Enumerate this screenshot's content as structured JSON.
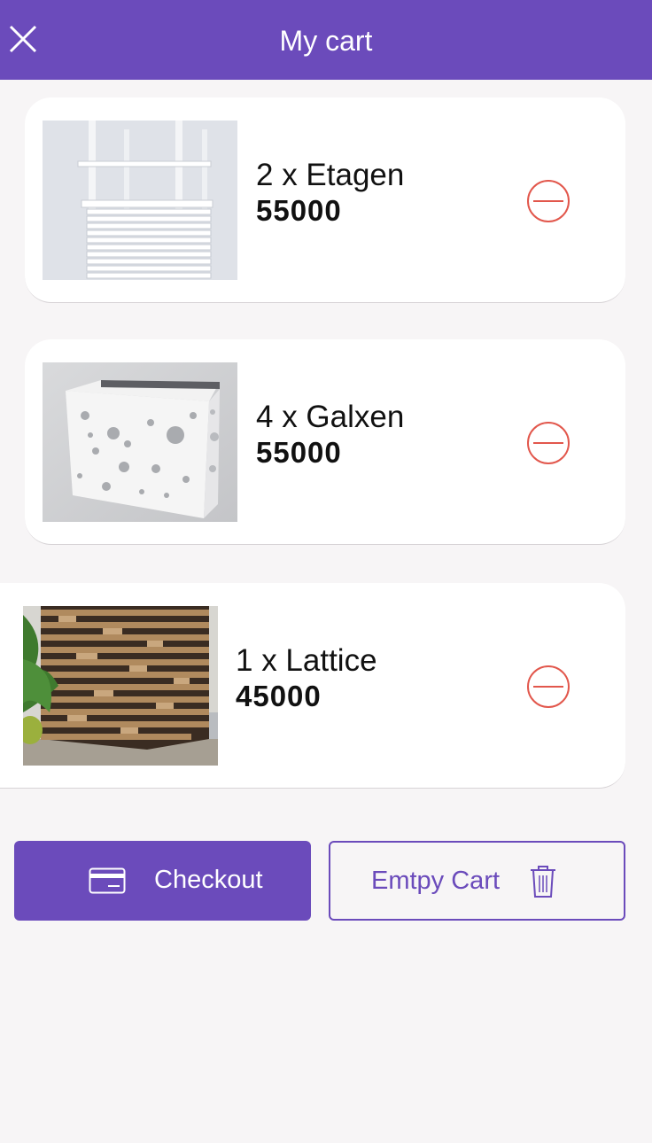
{
  "header": {
    "title": "My cart",
    "close_icon": "close-icon",
    "background": "#6b4bbb"
  },
  "cart": {
    "items": [
      {
        "name": "2 x Etagen",
        "price": "55000",
        "image": "white shelving unit product photo",
        "remove_icon": "remove-circle-icon"
      },
      {
        "name": "4 x Galxen",
        "price": "55000",
        "image": "white perforated cabinet product photo",
        "remove_icon": "remove-circle-icon"
      },
      {
        "name": "1 x Lattice",
        "price": "45000",
        "image": "wooden lattice planter product photo",
        "remove_icon": "remove-circle-icon"
      }
    ]
  },
  "actions": {
    "checkout_label": "Checkout",
    "checkout_icon": "credit-card-icon",
    "empty_label": "Emtpy Cart",
    "empty_icon": "trash-icon"
  },
  "colors": {
    "accent": "#6b4bbb",
    "remove": "#e2574c",
    "background": "#f7f5f6"
  }
}
